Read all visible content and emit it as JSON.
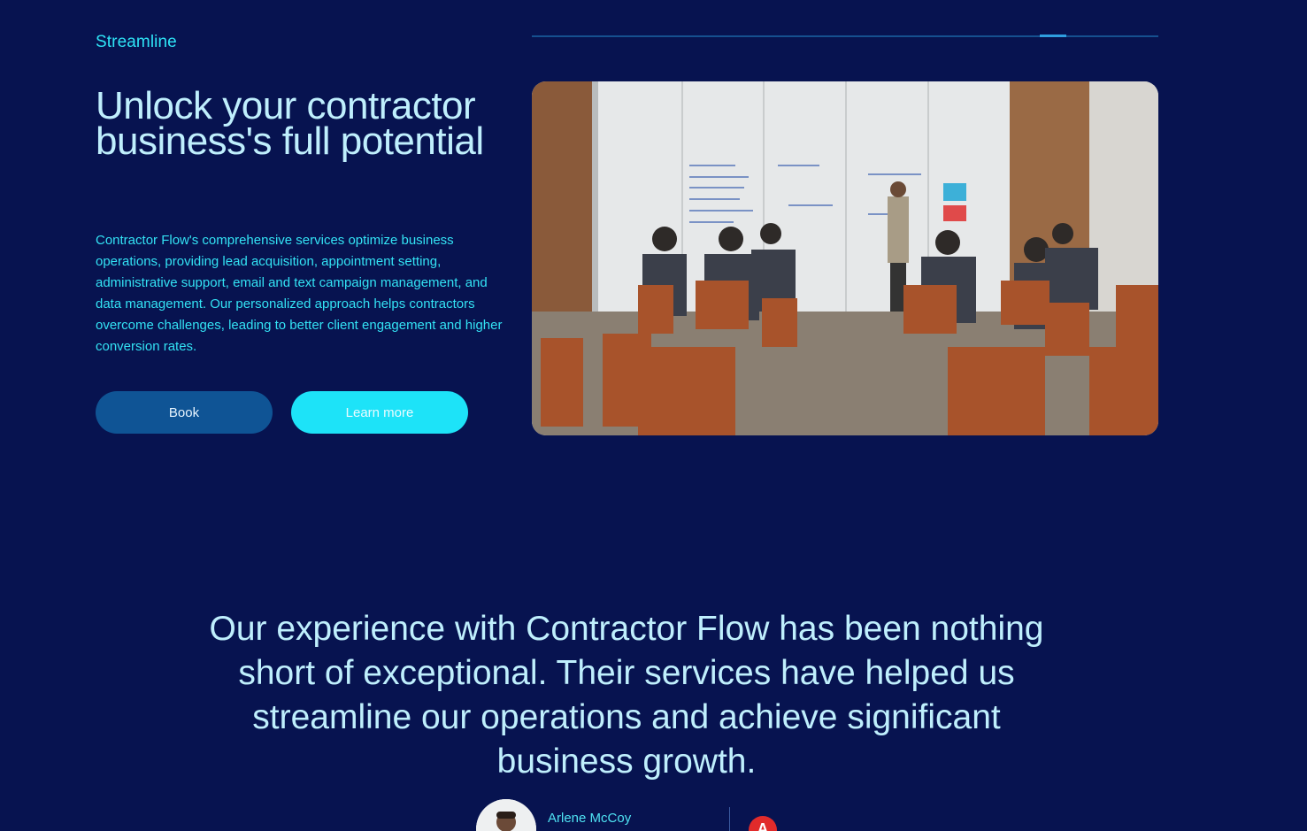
{
  "hero": {
    "eyebrow": "Streamline",
    "headline": "Unlock your contractor business's full potential",
    "description": "Contractor Flow's comprehensive services optimize business operations, providing lead acquisition, appointment setting, administrative support, email and text campaign management, and data management. Our personalized approach helps contractors overcome challenges, leading to better client engagement and higher conversion rates.",
    "primary_button": "Book",
    "secondary_button": "Learn more",
    "image_alt": "Presenter at a whiteboard in front of a seated audience"
  },
  "testimonial": {
    "quote": "Our experience with Contractor Flow has been nothing short of exceptional. Their services have helped us streamline our operations and achieve significant business growth.",
    "author_name": "Arlene McCoy",
    "company_logo_letter": "A"
  },
  "colors": {
    "background": "#071350",
    "accent_cyan": "#1de3f8",
    "heading": "#bfeffd",
    "button_dark": "#0f5495",
    "logo_red": "#e12b2b"
  }
}
